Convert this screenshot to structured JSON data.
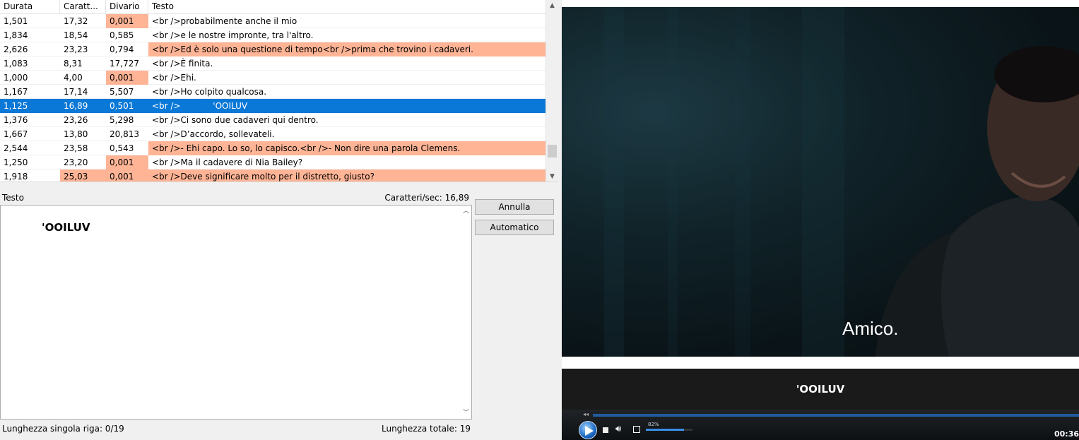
{
  "grid": {
    "columns": [
      "Durata",
      "Caratt...",
      "Divario",
      "Testo"
    ],
    "rows": [
      {
        "durata": "1,501",
        "caratteri": "17,32",
        "divario": "0,001",
        "testo": "<br />probabilmente anche il mio",
        "hl_div": true,
        "hl_car": false,
        "hl_txt": false,
        "selected": false
      },
      {
        "durata": "1,834",
        "caratteri": "18,54",
        "divario": "0,585",
        "testo": "<br />e le nostre impronte, tra l'altro.",
        "hl_div": false,
        "hl_car": false,
        "hl_txt": false,
        "selected": false
      },
      {
        "durata": "2,626",
        "caratteri": "23,23",
        "divario": "0,794",
        "testo": "<br />Ed è solo una questione di tempo<br />prima che trovino i cadaveri.",
        "hl_div": false,
        "hl_car": false,
        "hl_txt": true,
        "selected": false
      },
      {
        "durata": "1,083",
        "caratteri": "8,31",
        "divario": "17,727",
        "testo": "<br />È finita.",
        "hl_div": false,
        "hl_car": false,
        "hl_txt": false,
        "selected": false
      },
      {
        "durata": "1,000",
        "caratteri": "4,00",
        "divario": "0,001",
        "testo": "<br />Ehi.",
        "hl_div": true,
        "hl_car": false,
        "hl_txt": false,
        "selected": false
      },
      {
        "durata": "1,167",
        "caratteri": "17,14",
        "divario": "5,507",
        "testo": "<br />Ho colpito qualcosa.",
        "hl_div": false,
        "hl_car": false,
        "hl_txt": false,
        "selected": false
      },
      {
        "durata": "1,125",
        "caratteri": "16,89",
        "divario": "0,501",
        "testo": "<br />            'OOILUV",
        "hl_div": false,
        "hl_car": false,
        "hl_txt": false,
        "selected": true
      },
      {
        "durata": "1,376",
        "caratteri": "23,26",
        "divario": "5,298",
        "testo": "<br />Ci sono due cadaveri qui dentro.",
        "hl_div": false,
        "hl_car": false,
        "hl_txt": false,
        "selected": false
      },
      {
        "durata": "1,667",
        "caratteri": "13,80",
        "divario": "20,813",
        "testo": "<br />D’accordo, sollevateli.",
        "hl_div": false,
        "hl_car": false,
        "hl_txt": false,
        "selected": false
      },
      {
        "durata": "2,544",
        "caratteri": "23,58",
        "divario": "0,543",
        "testo": "<br />- Ehi capo. Lo so, lo capisco.<br />- Non dire una parola Clemens.",
        "hl_div": false,
        "hl_car": false,
        "hl_txt": true,
        "selected": false
      },
      {
        "durata": "1,250",
        "caratteri": "23,20",
        "divario": "0,001",
        "testo": "<br />Ma il cadavere di Nia Bailey?",
        "hl_div": true,
        "hl_car": false,
        "hl_txt": false,
        "selected": false
      },
      {
        "durata": "1,918",
        "caratteri": "25,03",
        "divario": "0,001",
        "testo": "<br />Deve significare molto per il distretto, giusto?",
        "hl_div": true,
        "hl_car": true,
        "hl_txt": true,
        "selected": false
      }
    ]
  },
  "editor": {
    "label": "Testo",
    "cps": "Caratteri/sec: 16,89",
    "text": "'OOILUV",
    "buttons": {
      "annulla": "Annulla",
      "automatico": "Automatico"
    },
    "status_left": "Lunghezza singola riga: 0/19",
    "status_right": "Lunghezza totale: 19"
  },
  "video": {
    "caption": "Amico.",
    "subtitle": "'OOILUV",
    "volume_label": "82%",
    "volume": 0.82,
    "time": "00:36"
  },
  "colors": {
    "highlight": "#ffb496",
    "selection": "#0a78d7"
  },
  "icons": [
    "chevron-up-icon",
    "chevron-down-icon",
    "play-icon",
    "stop-icon",
    "volume-icon",
    "fullscreen-icon"
  ]
}
